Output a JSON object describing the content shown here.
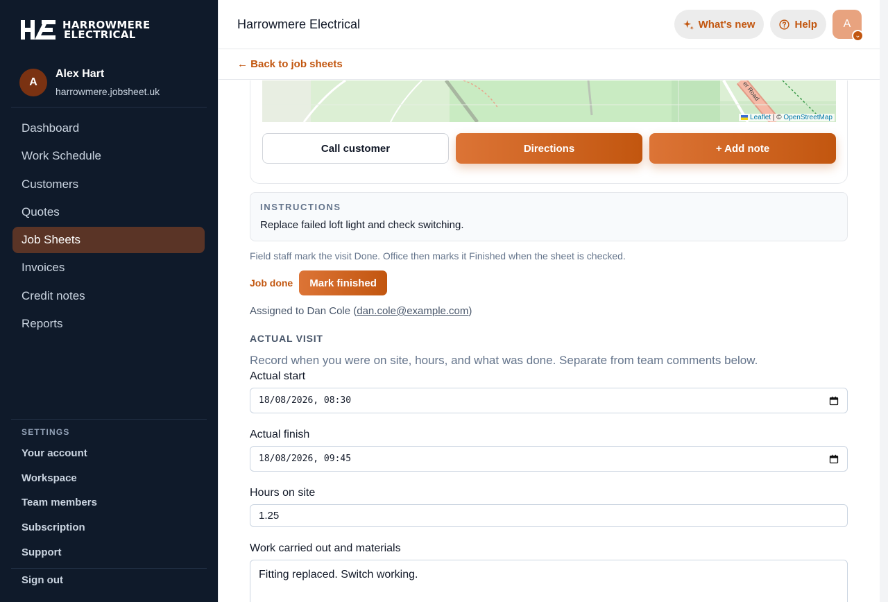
{
  "brand": {
    "logo_mark": "HE",
    "line1": "HARROWMERE",
    "line2": "ELECTRICAL"
  },
  "user": {
    "initial": "A",
    "name": "Alex Hart",
    "domain": "harrowmere.jobsheet.uk"
  },
  "nav": [
    {
      "label": "Dashboard"
    },
    {
      "label": "Work Schedule"
    },
    {
      "label": "Customers"
    },
    {
      "label": "Quotes"
    },
    {
      "label": "Job Sheets",
      "active": true
    },
    {
      "label": "Invoices"
    },
    {
      "label": "Credit notes"
    },
    {
      "label": "Reports"
    }
  ],
  "settings": {
    "heading": "SETTINGS",
    "items": [
      "Your account",
      "Workspace",
      "Team members",
      "Subscription",
      "Support"
    ],
    "signout": "Sign out"
  },
  "topbar": {
    "title": "Harrowmere Electrical",
    "whats_new": "What's new",
    "help": "Help",
    "avatar_initial": "A"
  },
  "back_link": "← Back to job sheets",
  "map": {
    "attribution_leaflet": "Leaflet",
    "attribution_sep": " | © ",
    "attribution_osm": "OpenStreetMap",
    "road_label": "er Road"
  },
  "actions": {
    "call": "Call customer",
    "directions": "Directions",
    "add_note": "+ Add note"
  },
  "instructions": {
    "label": "INSTRUCTIONS",
    "text": "Replace failed loft light and check switching."
  },
  "note": "Field staff mark the visit Done. Office then marks it Finished when the sheet is checked.",
  "status": {
    "job_done": "Job done",
    "mark_finished": "Mark finished"
  },
  "assigned": {
    "prefix": "Assigned to Dan Cole (",
    "email": "dan.cole@example.com",
    "suffix": ")"
  },
  "actual_visit": {
    "title": "ACTUAL VISIT",
    "subtitle": "Record when you were on site, hours, and what was done. Separate from team comments below.",
    "start_label": "Actual start",
    "start_value": "18/08/2026, 08:30",
    "finish_label": "Actual finish",
    "finish_value": "18/08/2026, 09:45",
    "hours_label": "Hours on site",
    "hours_value": "1.25",
    "work_label": "Work carried out and materials",
    "work_value": "Fitting replaced. Switch working."
  },
  "colors": {
    "accent": "#c2560f",
    "sidebar_bg": "#0f1a2a",
    "active_nav": "#5a3426"
  }
}
